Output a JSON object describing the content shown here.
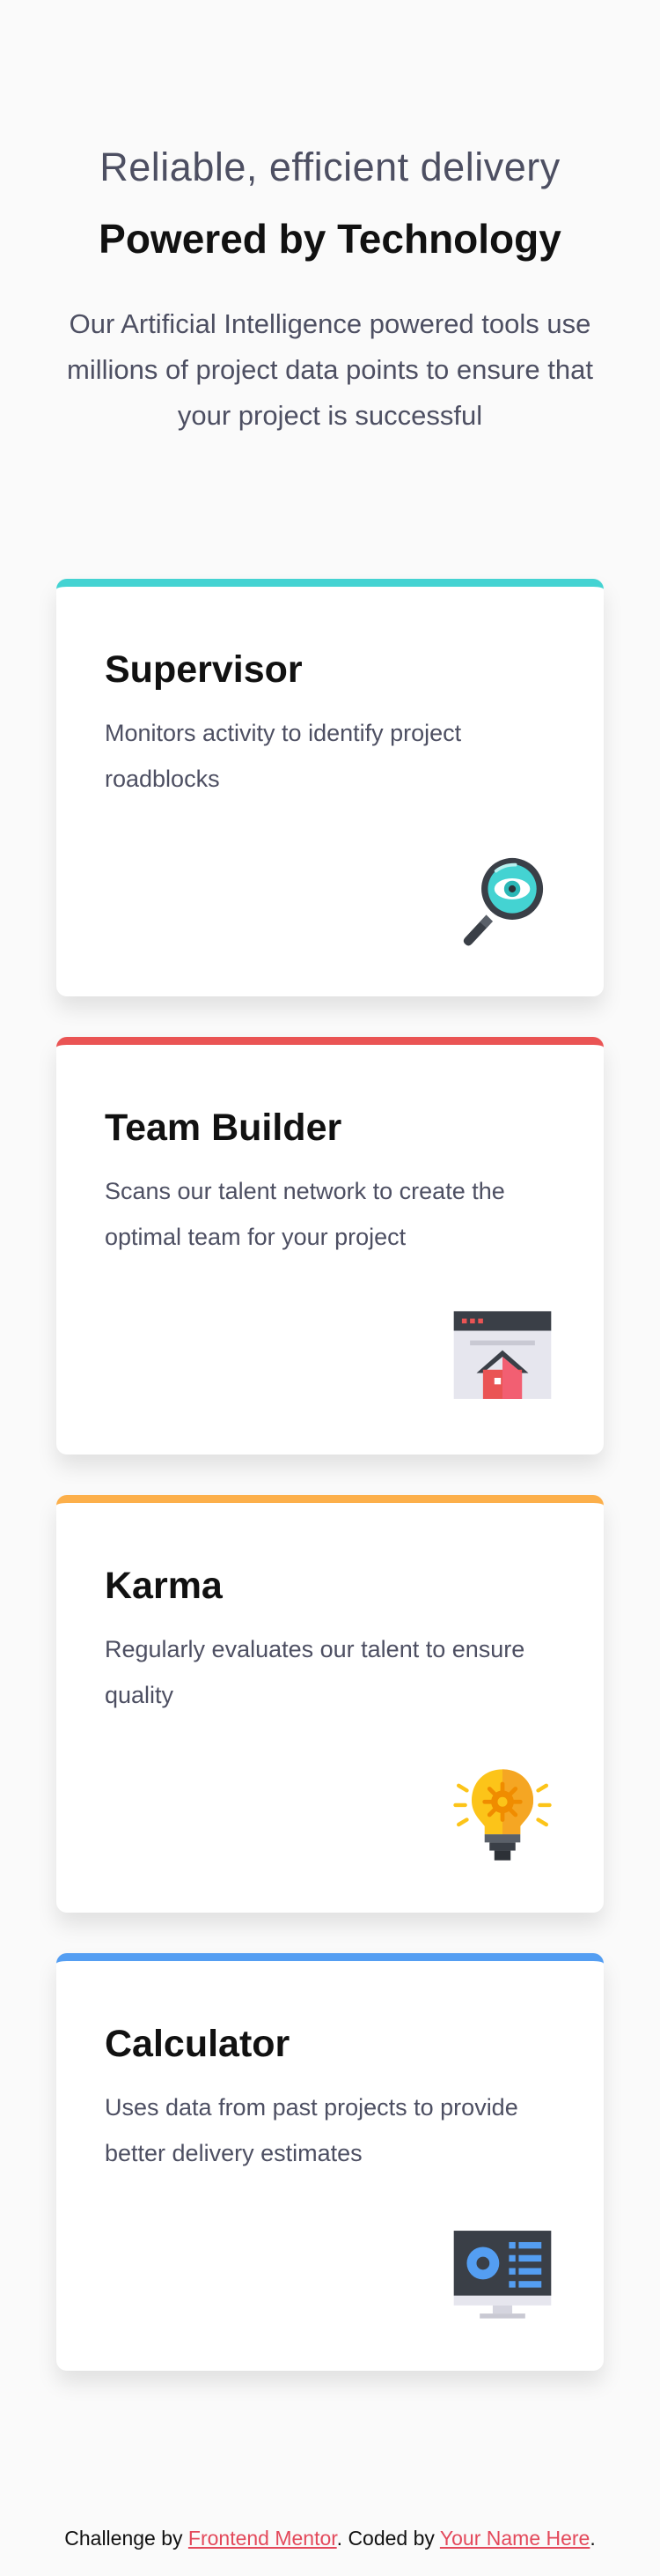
{
  "hero": {
    "title_light": "Reliable, efficient delivery",
    "title_bold": "Powered by Technology",
    "description": "Our Artificial Intelligence powered tools use millions of project data points to ensure that your project is successful"
  },
  "cards": [
    {
      "title": "Supervisor",
      "description": "Monitors activity to identify project roadblocks",
      "accent_color": "#44d3d2",
      "icon": "supervisor-magnifier-icon"
    },
    {
      "title": "Team Builder",
      "description": "Scans our talent network to create the optimal team for your project",
      "accent_color": "#ea5454",
      "icon": "team-builder-window-icon"
    },
    {
      "title": "Karma",
      "description": "Regularly evaluates our talent to ensure quality",
      "accent_color": "#fcaf4a",
      "icon": "karma-lightbulb-icon"
    },
    {
      "title": "Calculator",
      "description": "Uses data from past projects to provide better delivery estimates",
      "accent_color": "#549ef2",
      "icon": "calculator-monitor-icon"
    }
  ],
  "footer": {
    "prefix": "Challenge by ",
    "link1": "Frontend Mentor",
    "middle": ". Coded by ",
    "link2": "Your Name Here",
    "suffix": "."
  }
}
